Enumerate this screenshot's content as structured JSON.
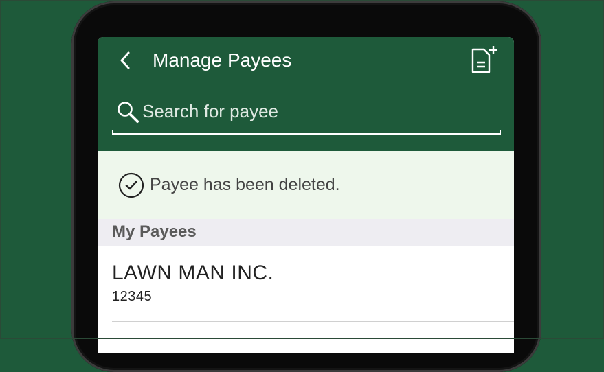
{
  "header": {
    "title": "Manage Payees",
    "back_icon": "chevron-left-icon",
    "add_icon": "document-plus-icon"
  },
  "search": {
    "placeholder": "Search for payee",
    "value": "",
    "icon": "search-icon"
  },
  "notice": {
    "text": "Payee has been deleted.",
    "icon": "check-circle-icon"
  },
  "section": {
    "title": "My Payees"
  },
  "payees": [
    {
      "name": "LAWN MAN INC.",
      "account": "12345"
    }
  ],
  "colors": {
    "brand_green": "#1e5a3a",
    "notice_bg": "#eef7ec",
    "section_bg": "#eeedf2"
  }
}
